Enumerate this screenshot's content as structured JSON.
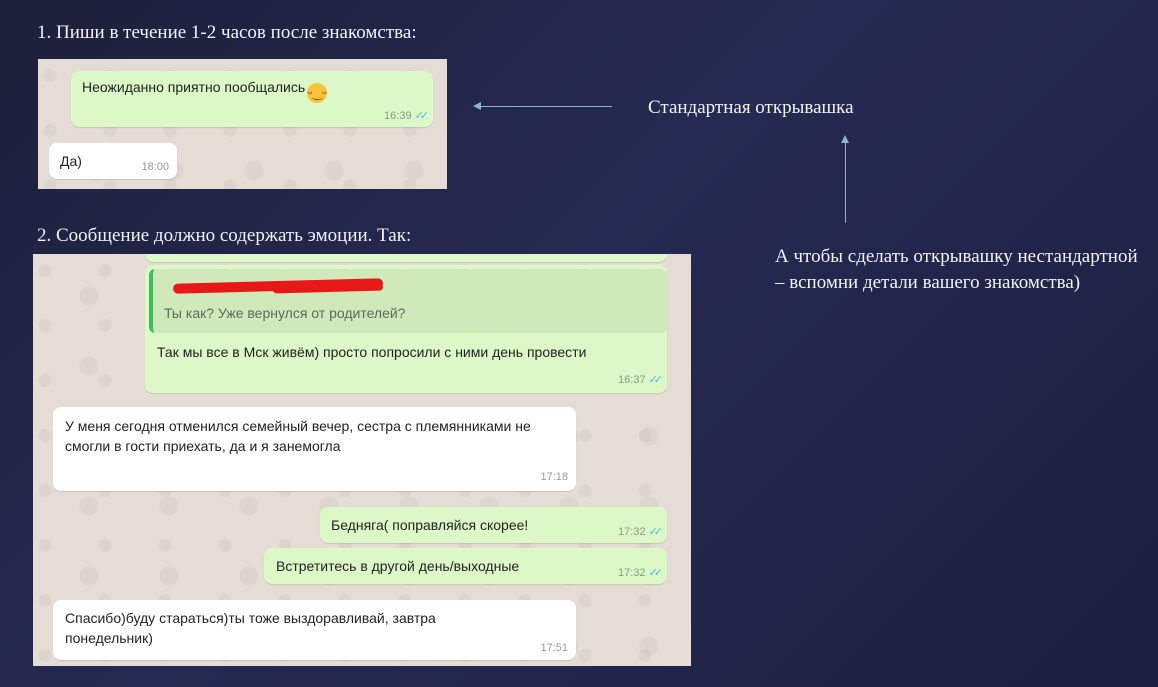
{
  "headings": {
    "step1": "1. Пиши в течение 1-2 часов после знакомства:",
    "step2": "2. Сообщение должно содержать эмоции. Так:"
  },
  "notes": {
    "standard": "Стандартная открывашка",
    "nonstandard": "А чтобы сделать открывашку нестандартной – вспомни детали вашего знакомства)"
  },
  "chat1": {
    "messages": [
      {
        "text": "Неожиданно приятно пообщались",
        "emoji": "smiling-face-emoji",
        "time": "16:39",
        "ticks": "✓✓"
      },
      {
        "text": "Да)",
        "time": "18:00"
      }
    ]
  },
  "chat2": {
    "messages": [
      {
        "quote": "Ты как? Уже вернулся от родителей?",
        "text": "Так мы все в Мск живём) просто попросили с ними день провести",
        "time": "16:37",
        "ticks": "✓✓"
      },
      {
        "text": "У меня сегодня отменился семейный вечер, сестра с племянниками не смогли в гости приехать, да и я занемогла",
        "time": "17:18"
      },
      {
        "text": "Бедняга( поправляйся скорее!",
        "time": "17:32",
        "ticks": "✓✓"
      },
      {
        "text": "Встретитесь в другой день/выходные",
        "time": "17:32",
        "ticks": "✓✓"
      },
      {
        "text": "Спасибо)буду стараться)ты тоже выздоравливай, завтра понедельник)",
        "time": "17:51"
      }
    ]
  },
  "colors": {
    "background": "#23264a",
    "outgoing_bubble": "#dcf8c6",
    "incoming_bubble": "#ffffff",
    "chat_background": "#e5ddd5",
    "read_ticks": "#4fb6ec",
    "arrow": "#8fb2d8",
    "redaction": "#e81818"
  }
}
